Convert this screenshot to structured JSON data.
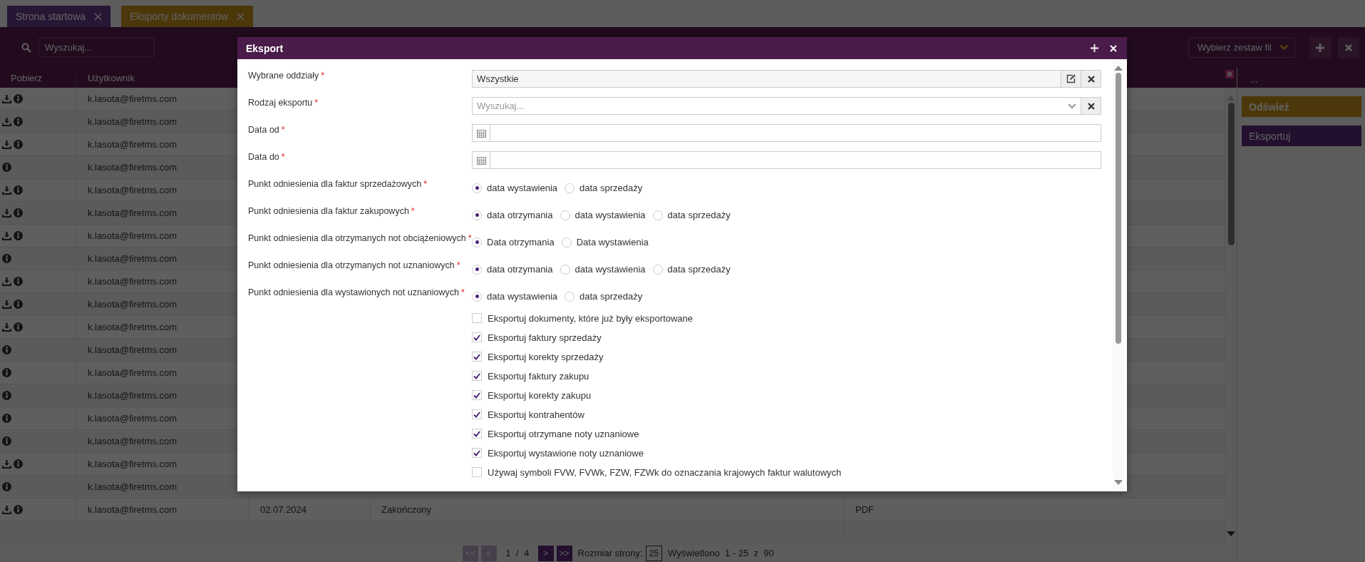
{
  "tabs": [
    {
      "label": "Strona startowa",
      "selected": false
    },
    {
      "label": "Eksporty dokumentów",
      "selected": true
    }
  ],
  "toolbar": {
    "search_placeholder": "Wyszukaj...",
    "filter_set": "Wybierz zestaw fil"
  },
  "table": {
    "columns": [
      "Pobierz",
      "Użytkownik"
    ],
    "more": "...",
    "rows": [
      {
        "download": true,
        "user": "k.lasota@firetms.com"
      },
      {
        "download": true,
        "user": "k.lasota@firetms.com"
      },
      {
        "download": true,
        "user": "k.lasota@firetms.com"
      },
      {
        "download": false,
        "user": "k.lasota@firetms.com"
      },
      {
        "download": true,
        "user": "k.lasota@firetms.com"
      },
      {
        "download": true,
        "user": "k.lasota@firetms.com"
      },
      {
        "download": true,
        "user": "k.lasota@firetms.com"
      },
      {
        "download": false,
        "user": "k.lasota@firetms.com"
      },
      {
        "download": true,
        "user": "k.lasota@firetms.com"
      },
      {
        "download": true,
        "user": "k.lasota@firetms.com"
      },
      {
        "download": true,
        "user": "k.lasota@firetms.com"
      },
      {
        "download": false,
        "user": "k.lasota@firetms.com"
      },
      {
        "download": false,
        "user": "k.lasota@firetms.com"
      },
      {
        "download": false,
        "user": "k.lasota@firetms.com"
      },
      {
        "download": false,
        "user": "k.lasota@firetms.com"
      },
      {
        "download": false,
        "user": "k.lasota@firetms.com"
      },
      {
        "download": true,
        "user": "k.lasota@firetms.com"
      },
      {
        "download": false,
        "user": "k.lasota@firetms.com"
      },
      {
        "download": true,
        "user": "k.lasota@firetms.com",
        "date": "02.07.2024",
        "status": "Zakończony",
        "format": "PDF"
      }
    ]
  },
  "pagination": {
    "first": "<<",
    "prev": "<",
    "page_info": "1 / 4",
    "next": ">",
    "last": ">>",
    "page_size_label": "Rozmiar strony:",
    "page_size": "25",
    "shown": "Wyświetlono  1 - 25  z  90"
  },
  "side_buttons": [
    {
      "label": "Odśwież",
      "kind": "refresh"
    },
    {
      "label": "Eksportuj",
      "kind": "export"
    }
  ],
  "modal": {
    "title": "Eksport",
    "fields": [
      {
        "kind": "branches",
        "label": "Wybrane oddziały",
        "mark": "*",
        "value": "Wszystkie"
      },
      {
        "kind": "search",
        "label": "Rodzaj eksportu",
        "mark": "*",
        "placeholder": "Wyszukaj..."
      },
      {
        "kind": "date",
        "label": "Data od",
        "mark": "*"
      },
      {
        "kind": "date",
        "label": "Data do",
        "mark": "*"
      },
      {
        "kind": "radio",
        "label": "Punkt odniesienia dla faktur sprzedażowych",
        "mark": "*",
        "options": [
          {
            "label": "data wystawienia",
            "selected": true
          },
          {
            "label": "data sprzedaży",
            "selected": false
          }
        ]
      },
      {
        "kind": "radio",
        "label": "Punkt odniesienia dla faktur zakupowych",
        "mark": "*",
        "options": [
          {
            "label": "data otrzymania",
            "selected": true
          },
          {
            "label": "data wystawienia",
            "selected": false
          },
          {
            "label": "data sprzedaży",
            "selected": false
          }
        ]
      },
      {
        "kind": "radio",
        "label": "Punkt odniesienia dla otrzymanych not obciążeniowych",
        "mark": "*",
        "options": [
          {
            "label": "Data otrzymania",
            "selected": true
          },
          {
            "label": "Data wystawienia",
            "selected": false
          }
        ]
      },
      {
        "kind": "radio",
        "label": "Punkt odniesienia dla otrzymanych not uznaniowych",
        "mark": "*",
        "options": [
          {
            "label": "data otrzymania",
            "selected": true
          },
          {
            "label": "data wystawienia",
            "selected": false
          },
          {
            "label": "data sprzedaży",
            "selected": false
          }
        ]
      },
      {
        "kind": "radio",
        "label": "Punkt odniesienia dla wystawionych not uznaniowych",
        "mark": "*",
        "options": [
          {
            "label": "data wystawienia",
            "selected": true
          },
          {
            "label": "data sprzedaży",
            "selected": false
          }
        ]
      }
    ],
    "checkboxes": [
      {
        "label": "Eksportuj dokumenty, które już były eksportowane",
        "checked": false
      },
      {
        "label": "Eksportuj faktury sprzedaży",
        "checked": true
      },
      {
        "label": "Eksportuj korekty sprzedaży",
        "checked": true
      },
      {
        "label": "Eksportuj faktury zakupu",
        "checked": true
      },
      {
        "label": "Eksportuj korekty zakupu",
        "checked": true
      },
      {
        "label": "Eksportuj kontrahentów",
        "checked": true
      },
      {
        "label": "Eksportuj otrzymane noty uznaniowe",
        "checked": true
      },
      {
        "label": "Eksportuj wystawione noty uznaniowe",
        "checked": true
      },
      {
        "label": "Używaj symboli FVW, FVWk, FZW, FZWk do oznaczania krajowych faktur walutowych",
        "checked": false
      }
    ]
  }
}
